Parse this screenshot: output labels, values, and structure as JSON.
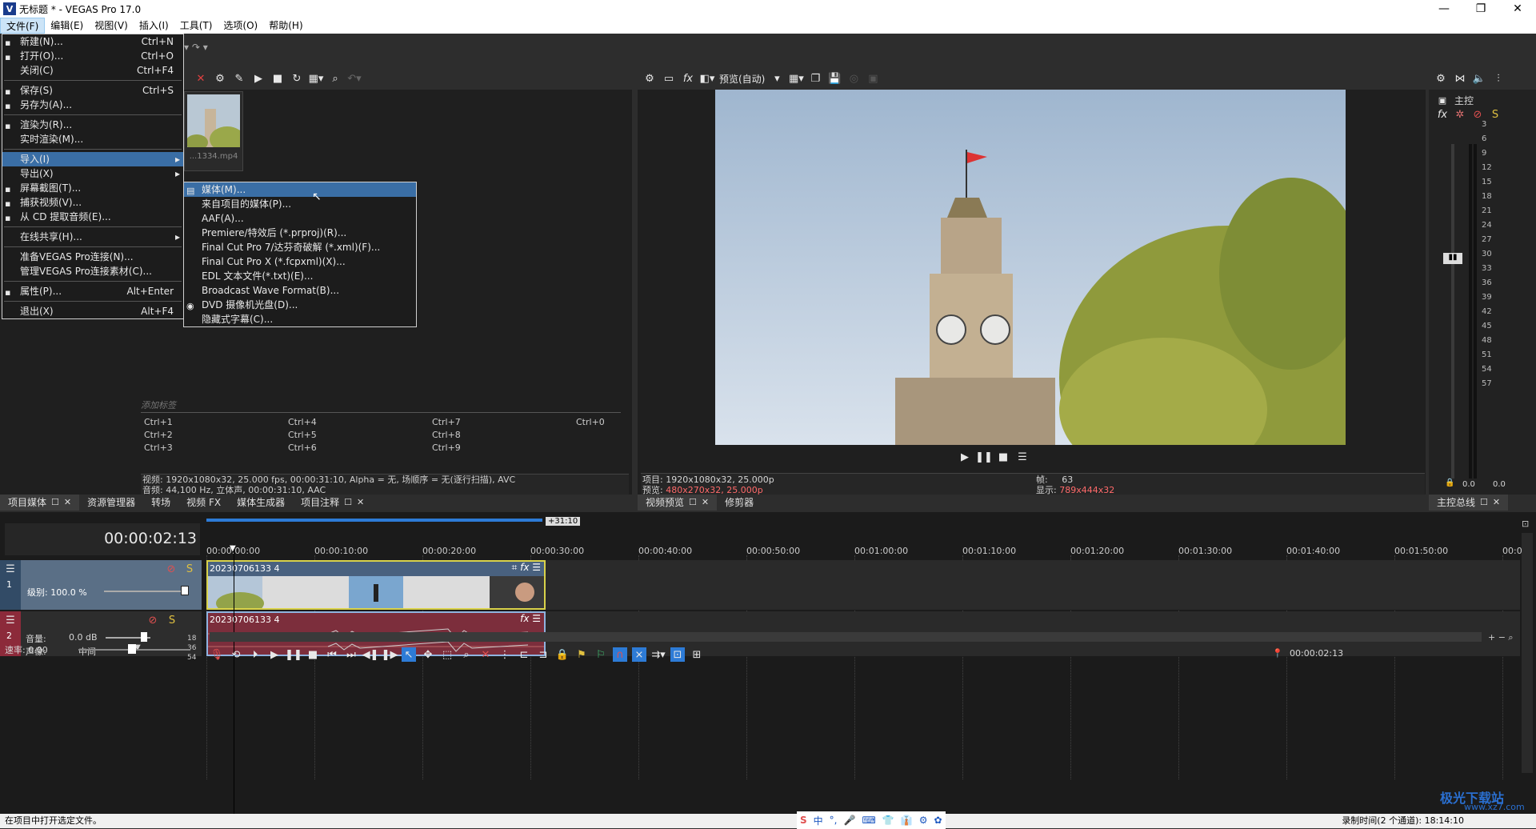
{
  "window": {
    "title": "无标题 * - VEGAS Pro 17.0",
    "logo": "V"
  },
  "menubar": [
    "文件(F)",
    "编辑(E)",
    "视图(V)",
    "插入(I)",
    "工具(T)",
    "选项(O)",
    "帮助(H)"
  ],
  "file_menu": [
    {
      "label": "新建(N)...",
      "shortcut": "Ctrl+N",
      "icon": "new-file-icon"
    },
    {
      "label": "打开(O)...",
      "shortcut": "Ctrl+O",
      "icon": "open-folder-icon"
    },
    {
      "label": "关闭(C)",
      "shortcut": "Ctrl+F4",
      "icon": ""
    },
    {
      "sep": true
    },
    {
      "label": "保存(S)",
      "shortcut": "Ctrl+S",
      "icon": "save-icon"
    },
    {
      "label": "另存为(A)...",
      "shortcut": "",
      "icon": "save-as-icon"
    },
    {
      "sep": true
    },
    {
      "label": "渲染为(R)...",
      "shortcut": "",
      "icon": "render-icon"
    },
    {
      "label": "实时渲染(M)...",
      "shortcut": "",
      "icon": ""
    },
    {
      "sep": true
    },
    {
      "label": "导入(I)",
      "shortcut": "",
      "icon": "",
      "submenu": true,
      "highlight": true
    },
    {
      "label": "导出(X)",
      "shortcut": "",
      "icon": "",
      "submenu": true
    },
    {
      "label": "屏幕截图(T)...",
      "shortcut": "",
      "icon": "screenshot-icon"
    },
    {
      "label": "捕获视频(V)...",
      "shortcut": "",
      "icon": "capture-icon"
    },
    {
      "label": "从 CD 提取音频(E)...",
      "shortcut": "",
      "icon": "cd-icon"
    },
    {
      "sep": true
    },
    {
      "label": "在线共享(H)...",
      "shortcut": "",
      "icon": "",
      "submenu": true
    },
    {
      "sep": true
    },
    {
      "label": "准备VEGAS Pro连接(N)...",
      "shortcut": "",
      "icon": ""
    },
    {
      "label": "管理VEGAS Pro连接素材(C)...",
      "shortcut": "",
      "icon": ""
    },
    {
      "sep": true
    },
    {
      "label": "属性(P)...",
      "shortcut": "Alt+Enter",
      "icon": "gear-icon"
    },
    {
      "sep": true
    },
    {
      "label": "退出(X)",
      "shortcut": "Alt+F4",
      "icon": ""
    }
  ],
  "import_submenu": [
    {
      "label": "媒体(M)...",
      "icon": "media-icon",
      "highlight": true
    },
    {
      "label": "来自项目的媒体(P)...",
      "icon": ""
    },
    {
      "label": "AAF(A)...",
      "icon": ""
    },
    {
      "label": "Premiere/特效后 (*.prproj)(R)...",
      "icon": ""
    },
    {
      "label": "Final Cut Pro 7/达芬奇破解 (*.xml)(F)...",
      "icon": ""
    },
    {
      "label": "Final Cut Pro X (*.fcpxml)(X)...",
      "icon": ""
    },
    {
      "label": "EDL 文本文件(*.txt)(E)...",
      "icon": ""
    },
    {
      "label": "Broadcast Wave Format(B)...",
      "icon": ""
    },
    {
      "label": "DVD 摄像机光盘(D)...",
      "icon": "dvd-icon"
    },
    {
      "label": "隐藏式字幕(C)...",
      "icon": ""
    }
  ],
  "media": {
    "thumb_caption": "...1334.mp4",
    "tag_placeholder": "添加标签",
    "shortcuts": [
      "Ctrl+1",
      "Ctrl+4",
      "Ctrl+7",
      "Ctrl+0",
      "Ctrl+2",
      "Ctrl+5",
      "Ctrl+8",
      "",
      "Ctrl+3",
      "Ctrl+6",
      "Ctrl+9",
      ""
    ],
    "info_video": "视频: 1920x1080x32, 25.000 fps, 00:00:31:10, Alpha = 无, 场顺序 = 无(逐行扫描), AVC",
    "info_audio": "音频: 44,100 Hz, 立体声, 00:00:31:10, AAC"
  },
  "left_tabs": [
    {
      "label": "项目媒体",
      "closable": true
    },
    {
      "label": "资源管理器",
      "closable": false
    },
    {
      "label": "转场",
      "closable": false
    },
    {
      "label": "视频 FX",
      "closable": false
    },
    {
      "label": "媒体生成器",
      "closable": false
    },
    {
      "label": "项目注释",
      "closable": true
    }
  ],
  "preview": {
    "quality": "预览(自动)",
    "project_label": "项目:",
    "project_val": "1920x1080x32, 25.000p",
    "preview_label": "预览:",
    "preview_val": "480x270x32, 25.000p",
    "frame_label": "帧:",
    "frame_val": "63",
    "display_label": "显示:",
    "display_val": "789x444x32",
    "tabs": [
      "视频预览",
      "修剪器"
    ]
  },
  "mixer": {
    "title": "主控",
    "ticks": [
      "3",
      "6",
      "9",
      "12",
      "15",
      "18",
      "21",
      "24",
      "27",
      "30",
      "33",
      "36",
      "39",
      "42",
      "45",
      "48",
      "51",
      "54",
      "57"
    ],
    "bottom_left": "0.0",
    "bottom_right": "0.0",
    "tab": "主控总线"
  },
  "timeline": {
    "timecode": "00:00:02:13",
    "end_marker": "+31:10",
    "ruler": [
      "00:00:00:00",
      "00:00:10:00",
      "00:00:20:00",
      "00:00:30:00",
      "00:00:40:00",
      "00:00:50:00",
      "00:01:00:00",
      "00:01:10:00",
      "00:01:20:00",
      "00:01:30:00",
      "00:01:40:00",
      "00:01:50:00",
      "00:0"
    ],
    "video_track": {
      "num": "1",
      "level_label": "级别: 100.0 %",
      "clip_name": "20230706133 4"
    },
    "audio_track": {
      "num": "2",
      "vol_label": "音量:",
      "vol_val": "0.0 dB",
      "pan_label": "声像:",
      "pan_val": "中间",
      "clip_name": "20230706133 4",
      "db": [
        "18",
        "36",
        "54"
      ]
    },
    "rate_label": "速率: 0.00",
    "cursor_time": "00:00:02:13"
  },
  "status": {
    "left": "在项目中打开选定文件。",
    "right": "录制时间(2 个通道): 18:14:10",
    "watermark": "极光下载站",
    "watermark_url": "www.xz7.com"
  },
  "ime": [
    "中",
    "°,",
    "🎤",
    "⌨",
    "👕",
    "👔",
    "⚙",
    "✿"
  ]
}
